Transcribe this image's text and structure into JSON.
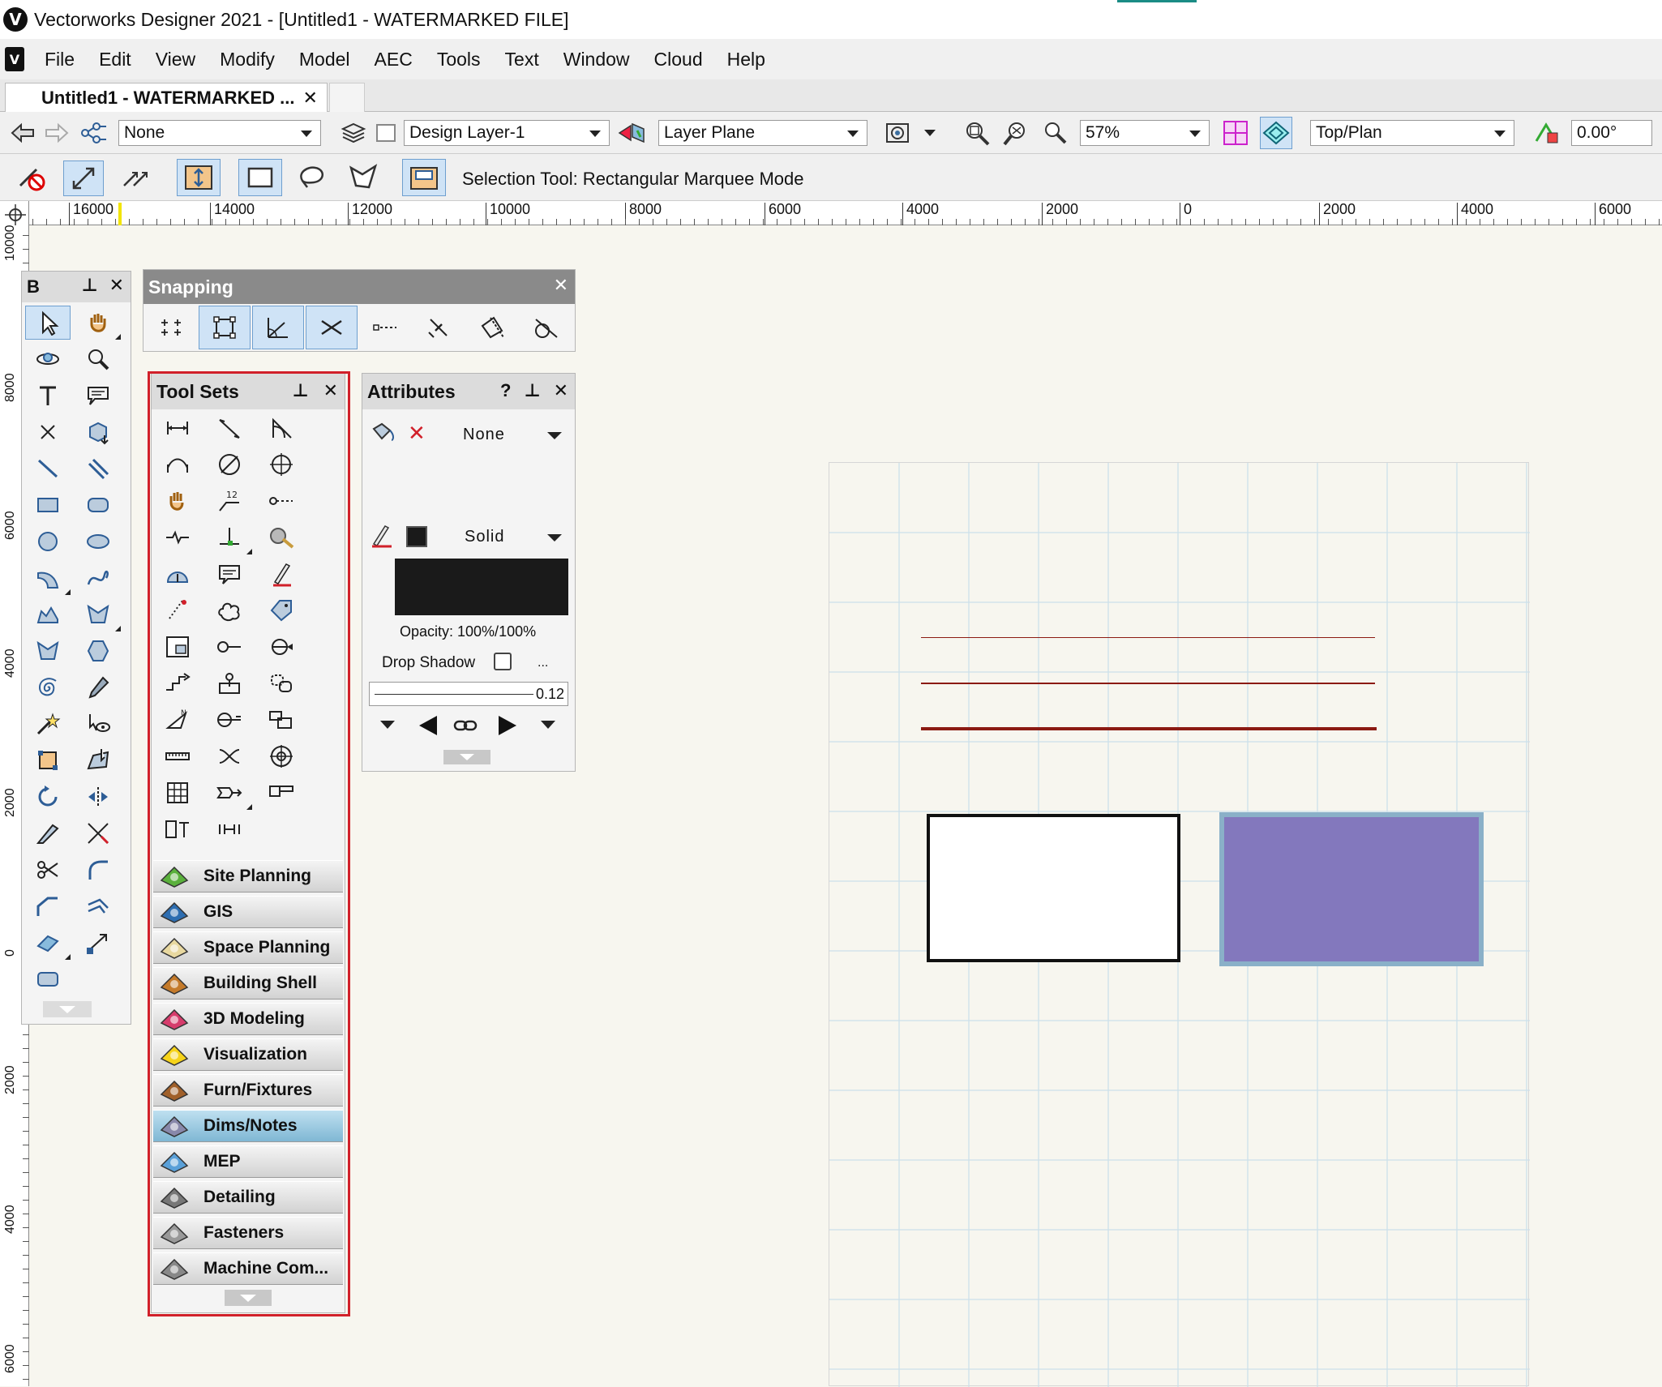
{
  "window": {
    "title": "Vectorworks Designer 2021 - [Untitled1 - WATERMARKED FILE]",
    "logo_letter": "V"
  },
  "menu": [
    "File",
    "Edit",
    "View",
    "Modify",
    "Model",
    "AEC",
    "Tools",
    "Text",
    "Window",
    "Cloud",
    "Help"
  ],
  "tab": {
    "label": "Untitled1 - WATERMARKED ...",
    "close": "✕"
  },
  "view_bar": {
    "class_value": "None",
    "layer_value": "Design Layer-1",
    "plane_value": "Layer Plane",
    "zoom_value": "57%",
    "view_value": "Top/Plan",
    "rotation_value": "0.00°"
  },
  "tool_mode": {
    "status": "Selection Tool: Rectangular Marquee Mode"
  },
  "rulers": {
    "top": [
      "16000",
      "14000",
      "12000",
      "10000",
      "8000",
      "6000",
      "4000",
      "2000",
      "0",
      "2000",
      "4000",
      "6000"
    ],
    "left": [
      "10000",
      "8000",
      "6000",
      "4000",
      "2000",
      "0",
      "2000",
      "4000",
      "6000"
    ]
  },
  "basic_palette": {
    "title": "B",
    "pin": "⊥",
    "close": "✕"
  },
  "snapping": {
    "title": "Snapping",
    "close": "✕"
  },
  "tool_sets": {
    "title": "Tool Sets",
    "pin": "⊥",
    "close": "✕",
    "sets": [
      {
        "label": "Site Planning",
        "icon": "site-planning-icon",
        "active": false
      },
      {
        "label": "GIS",
        "icon": "gis-icon",
        "active": false
      },
      {
        "label": "Space Planning",
        "icon": "space-planning-icon",
        "active": false
      },
      {
        "label": "Building Shell",
        "icon": "building-shell-icon",
        "active": false
      },
      {
        "label": "3D Modeling",
        "icon": "3d-modeling-icon",
        "active": false
      },
      {
        "label": "Visualization",
        "icon": "visualization-icon",
        "active": false
      },
      {
        "label": "Furn/Fixtures",
        "icon": "furn-fixtures-icon",
        "active": false
      },
      {
        "label": "Dims/Notes",
        "icon": "dims-notes-icon",
        "active": true
      },
      {
        "label": "MEP",
        "icon": "mep-icon",
        "active": false
      },
      {
        "label": "Detailing",
        "icon": "detailing-icon",
        "active": false
      },
      {
        "label": "Fasteners",
        "icon": "fasteners-icon",
        "active": false
      },
      {
        "label": "Machine Com...",
        "icon": "machine-components-icon",
        "active": false
      }
    ]
  },
  "attributes": {
    "title": "Attributes",
    "help": "?",
    "pin": "⊥",
    "close": "✕",
    "fill_style": "None",
    "pen_style": "Solid",
    "pen_color": "#1a1a1a",
    "opacity": "Opacity: 100%/100%",
    "drop_shadow": "Drop Shadow",
    "more": "...",
    "line_thickness": "0.12"
  },
  "colors": {
    "selection_highlight": "#cfe3f6",
    "red_frame": "#d1202a",
    "line_color": "#8b1a12",
    "purple_fill": "#8378bd",
    "purple_border": "#8ab0c8"
  }
}
